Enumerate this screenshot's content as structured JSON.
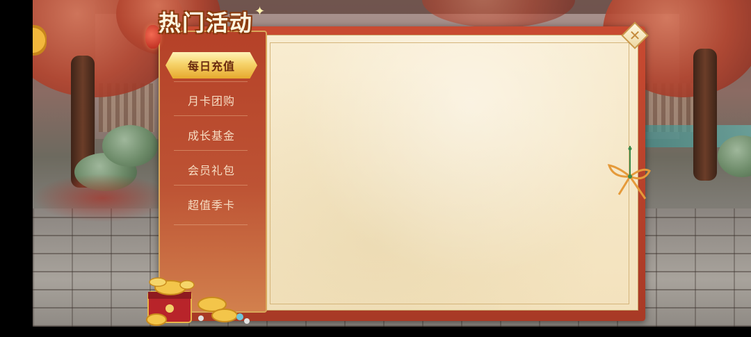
{
  "panel": {
    "title": "热门活动",
    "close_icon": "close-x-icon"
  },
  "sidebar": {
    "items": [
      {
        "label": "每日充值",
        "selected": true
      },
      {
        "label": "月卡团购",
        "selected": false
      },
      {
        "label": "成长基金",
        "selected": false
      },
      {
        "label": "会员礼包",
        "selected": false
      },
      {
        "label": "超值季卡",
        "selected": false
      }
    ]
  },
  "decor": {
    "lantern": "lantern-icon",
    "treasure": "gold-ingot-treasure-icon",
    "knot": "rope-knot-icon",
    "sparkle": "sparkle-icon"
  },
  "colors": {
    "frame_red": "#b8432b",
    "selected_gold": "#f6d36a",
    "paper": "#f6e7c7"
  }
}
